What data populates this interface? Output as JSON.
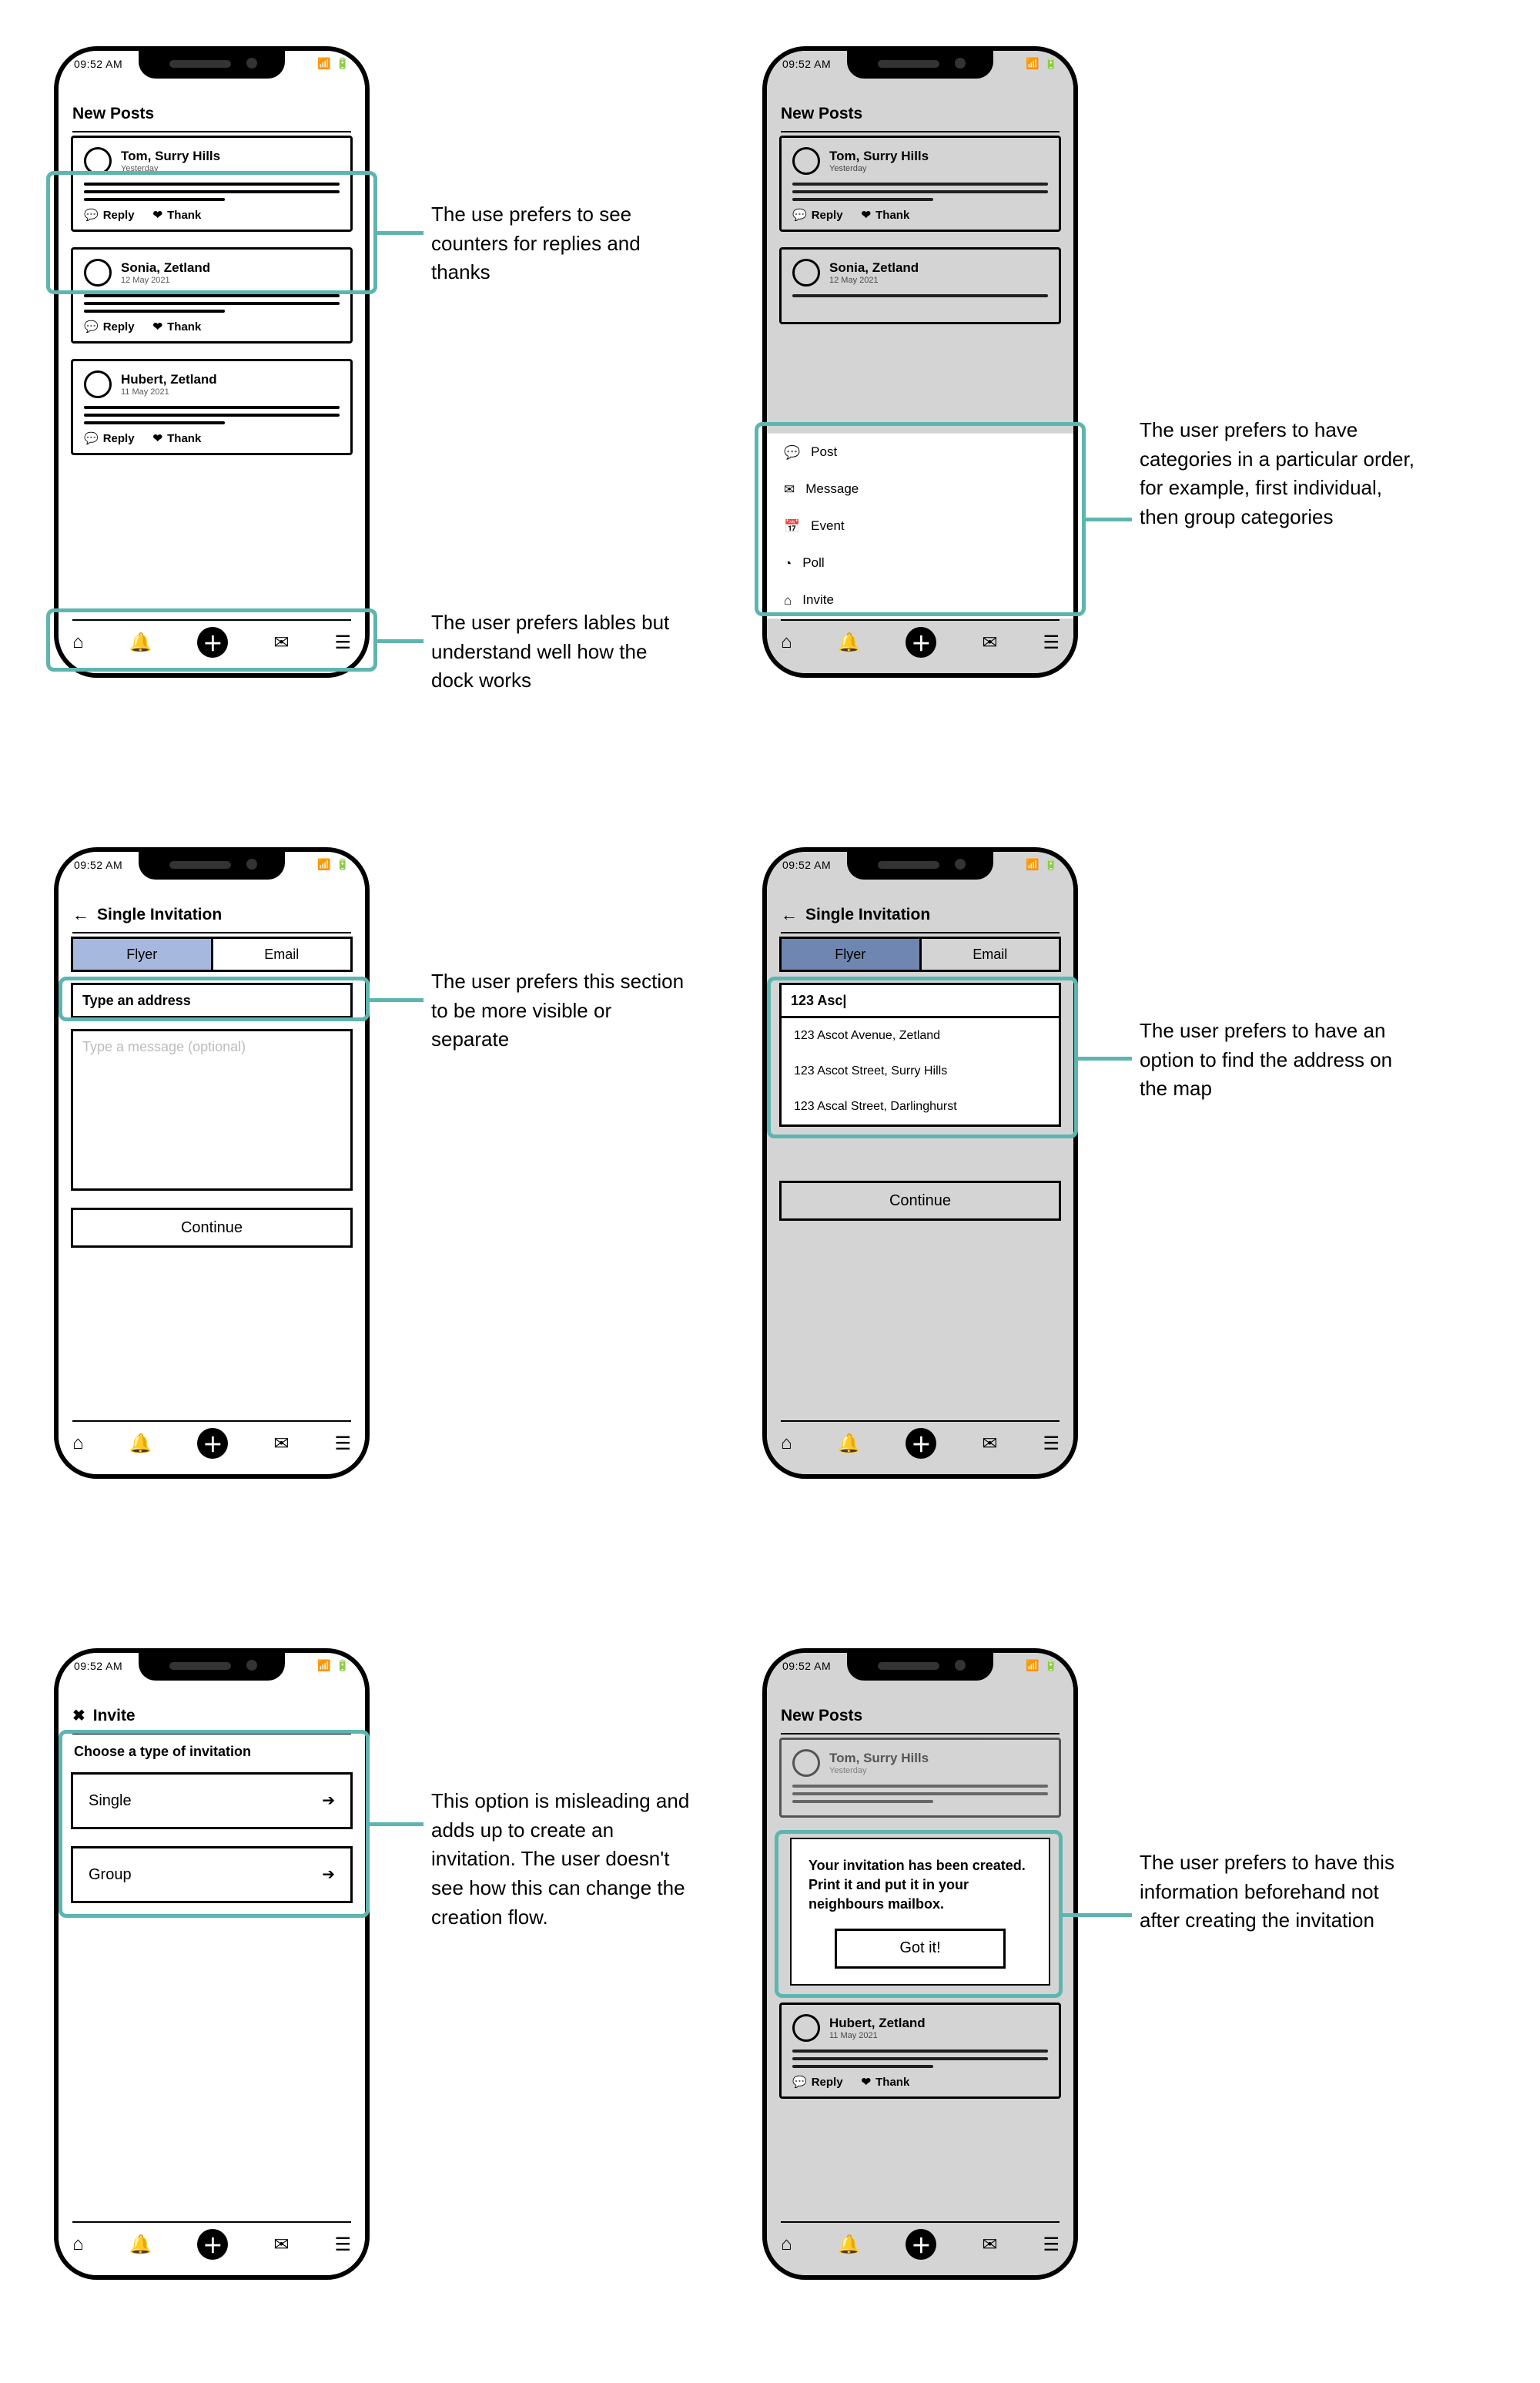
{
  "status": {
    "time": "09:52 AM"
  },
  "dock_labels": {
    "home": "home-icon",
    "bell": "bell-icon",
    "add": "add-icon",
    "mail": "mail-icon",
    "menu": "menu-icon"
  },
  "posts_header": "New Posts",
  "post_reply_label": "Reply",
  "post_thank_label": "Thank",
  "posts": [
    {
      "name": "Tom, Surry Hills",
      "date": "Yesterday"
    },
    {
      "name": "Sonia, Zetland",
      "date": "12 May 2021"
    },
    {
      "name": "Hubert, Zetland",
      "date": "11 May 2021"
    }
  ],
  "compose_menu": [
    {
      "icon": "💬",
      "label": "Post"
    },
    {
      "icon": "✉",
      "label": "Message"
    },
    {
      "icon": "📅",
      "label": "Event"
    },
    {
      "icon": "◔",
      "label": "Poll"
    },
    {
      "icon": "⌂",
      "label": "Invite"
    }
  ],
  "invite": {
    "header": "Single Invitation",
    "tab_flyer": "Flyer",
    "tab_email": "Email",
    "address_placeholder": "Type an address",
    "address_typed": "123 Asc|",
    "message_placeholder": "Type a message (optional)",
    "continue": "Continue",
    "suggestions": [
      "123 Ascot Avenue, Zetland",
      "123 Ascot Street, Surry Hills",
      "123 Ascal Street, Darlinghurst"
    ]
  },
  "invite_type": {
    "header": "Invite",
    "prompt": "Choose a type of invitation",
    "single": "Single",
    "group": "Group"
  },
  "toast": {
    "text": "Your invitation has been created. Print it and put it in your neighbours mailbox.",
    "ok": "Got it!"
  },
  "annotations": {
    "a1": "The use prefers to see counters for replies and thanks",
    "a2": "The user prefers lables but understand well how the dock works",
    "a3": "The user prefers to have categories in a particular order, for example, first individual, then group categories",
    "a4": "The user prefers this section to be more visible or separate",
    "a5": "The user prefers to have an option to find the address on the map",
    "a6": "This option is misleading and adds up to create an invitation. The user doesn't see how this can change the creation flow.",
    "a7": "The user prefers to have this information beforehand not after creating the invitation"
  }
}
